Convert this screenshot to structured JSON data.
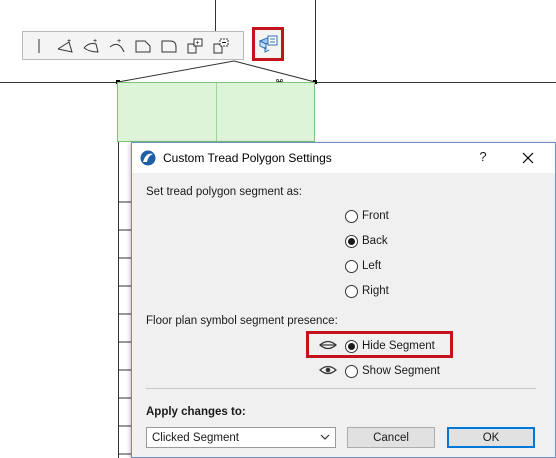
{
  "dialog": {
    "title": "Custom Tread Polygon Settings",
    "help_label": "?",
    "segment_label": "Set tread polygon segment as:",
    "segment_options": [
      "Front",
      "Back",
      "Left",
      "Right"
    ],
    "segment_selected": "Back",
    "presence_label": "Floor plan symbol segment presence:",
    "presence_options": [
      "Hide Segment",
      "Show Segment"
    ],
    "presence_selected": "Hide Segment",
    "apply_label": "Apply changes to:",
    "apply_value": "Clicked Segment",
    "cancel_label": "Cancel",
    "ok_label": "OK"
  },
  "toolbar": {
    "icons": [
      "line-icon",
      "arc-three-point-icon",
      "arc-tangent-icon",
      "arc-curve-icon",
      "chamfer-icon",
      "fillet-icon",
      "add-polygon-icon",
      "subtract-polygon-icon",
      "custom-settings-icon"
    ]
  },
  "colors": {
    "highlight": "#c0161b",
    "tread_fill": "#def4d9",
    "dialog_bg": "#f0f0f0",
    "accent": "#0078d7"
  }
}
